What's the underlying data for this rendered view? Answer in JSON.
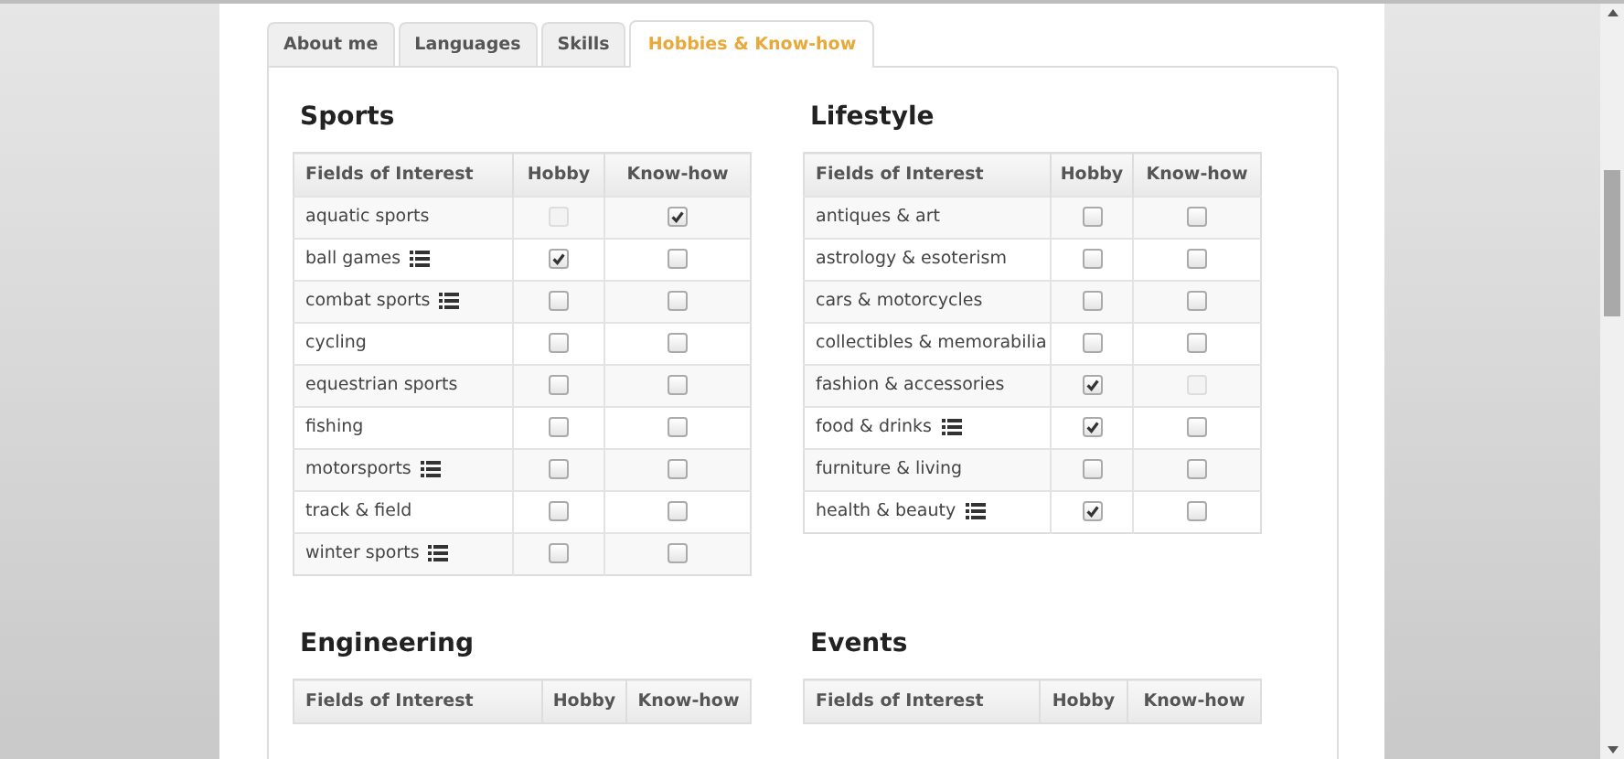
{
  "tabs": [
    {
      "label": "About me",
      "selected": false
    },
    {
      "label": "Languages",
      "selected": false
    },
    {
      "label": "Skills",
      "selected": false
    },
    {
      "label": "Hobbies & Know-how",
      "selected": true
    }
  ],
  "sections": [
    {
      "title": "Sports",
      "columns": [
        "Fields of Interest",
        "Hobby",
        "Know-how"
      ],
      "rows": [
        {
          "name": "aquatic sports",
          "list_icon": false,
          "hobby": {
            "checked": false,
            "disabled": true
          },
          "know_how": {
            "checked": true,
            "disabled": false
          }
        },
        {
          "name": "ball games",
          "list_icon": true,
          "hobby": {
            "checked": true,
            "disabled": false
          },
          "know_how": {
            "checked": false,
            "disabled": false
          }
        },
        {
          "name": "combat sports",
          "list_icon": true,
          "hobby": {
            "checked": false,
            "disabled": false
          },
          "know_how": {
            "checked": false,
            "disabled": false
          }
        },
        {
          "name": "cycling",
          "list_icon": false,
          "hobby": {
            "checked": false,
            "disabled": false
          },
          "know_how": {
            "checked": false,
            "disabled": false
          }
        },
        {
          "name": "equestrian sports",
          "list_icon": false,
          "hobby": {
            "checked": false,
            "disabled": false
          },
          "know_how": {
            "checked": false,
            "disabled": false
          }
        },
        {
          "name": "fishing",
          "list_icon": false,
          "hobby": {
            "checked": false,
            "disabled": false
          },
          "know_how": {
            "checked": false,
            "disabled": false
          }
        },
        {
          "name": "motorsports",
          "list_icon": true,
          "hobby": {
            "checked": false,
            "disabled": false
          },
          "know_how": {
            "checked": false,
            "disabled": false
          }
        },
        {
          "name": "track & field",
          "list_icon": false,
          "hobby": {
            "checked": false,
            "disabled": false
          },
          "know_how": {
            "checked": false,
            "disabled": false
          }
        },
        {
          "name": "winter sports",
          "list_icon": true,
          "hobby": {
            "checked": false,
            "disabled": false
          },
          "know_how": {
            "checked": false,
            "disabled": false
          }
        }
      ]
    },
    {
      "title": "Lifestyle",
      "columns": [
        "Fields of Interest",
        "Hobby",
        "Know-how"
      ],
      "rows": [
        {
          "name": "antiques & art",
          "list_icon": false,
          "hobby": {
            "checked": false,
            "disabled": false
          },
          "know_how": {
            "checked": false,
            "disabled": false
          }
        },
        {
          "name": "astrology & esoterism",
          "list_icon": false,
          "hobby": {
            "checked": false,
            "disabled": false
          },
          "know_how": {
            "checked": false,
            "disabled": false
          }
        },
        {
          "name": "cars & motorcycles",
          "list_icon": false,
          "hobby": {
            "checked": false,
            "disabled": false
          },
          "know_how": {
            "checked": false,
            "disabled": false
          }
        },
        {
          "name": "collectibles & memorabilia",
          "list_icon": false,
          "hobby": {
            "checked": false,
            "disabled": false
          },
          "know_how": {
            "checked": false,
            "disabled": false
          }
        },
        {
          "name": "fashion & accessories",
          "list_icon": false,
          "hobby": {
            "checked": true,
            "disabled": false
          },
          "know_how": {
            "checked": false,
            "disabled": true
          }
        },
        {
          "name": "food & drinks",
          "list_icon": true,
          "hobby": {
            "checked": true,
            "disabled": false
          },
          "know_how": {
            "checked": false,
            "disabled": false
          }
        },
        {
          "name": "furniture & living",
          "list_icon": false,
          "hobby": {
            "checked": false,
            "disabled": false
          },
          "know_how": {
            "checked": false,
            "disabled": false
          }
        },
        {
          "name": "health & beauty",
          "list_icon": true,
          "hobby": {
            "checked": true,
            "disabled": false
          },
          "know_how": {
            "checked": false,
            "disabled": false
          }
        }
      ]
    },
    {
      "title": "Engineering",
      "columns": [
        "Fields of Interest",
        "Hobby",
        "Know-how"
      ]
    },
    {
      "title": "Events",
      "columns": [
        "Fields of Interest",
        "Hobby",
        "Know-how"
      ]
    }
  ]
}
